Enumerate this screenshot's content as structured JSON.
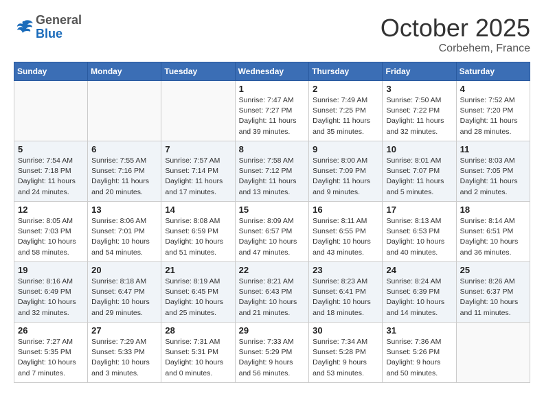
{
  "header": {
    "logo_general": "General",
    "logo_blue": "Blue",
    "month_title": "October 2025",
    "location": "Corbehem, France"
  },
  "days_of_week": [
    "Sunday",
    "Monday",
    "Tuesday",
    "Wednesday",
    "Thursday",
    "Friday",
    "Saturday"
  ],
  "weeks": [
    [
      {
        "day": "",
        "info": ""
      },
      {
        "day": "",
        "info": ""
      },
      {
        "day": "",
        "info": ""
      },
      {
        "day": "1",
        "info": "Sunrise: 7:47 AM\nSunset: 7:27 PM\nDaylight: 11 hours\nand 39 minutes."
      },
      {
        "day": "2",
        "info": "Sunrise: 7:49 AM\nSunset: 7:25 PM\nDaylight: 11 hours\nand 35 minutes."
      },
      {
        "day": "3",
        "info": "Sunrise: 7:50 AM\nSunset: 7:22 PM\nDaylight: 11 hours\nand 32 minutes."
      },
      {
        "day": "4",
        "info": "Sunrise: 7:52 AM\nSunset: 7:20 PM\nDaylight: 11 hours\nand 28 minutes."
      }
    ],
    [
      {
        "day": "5",
        "info": "Sunrise: 7:54 AM\nSunset: 7:18 PM\nDaylight: 11 hours\nand 24 minutes."
      },
      {
        "day": "6",
        "info": "Sunrise: 7:55 AM\nSunset: 7:16 PM\nDaylight: 11 hours\nand 20 minutes."
      },
      {
        "day": "7",
        "info": "Sunrise: 7:57 AM\nSunset: 7:14 PM\nDaylight: 11 hours\nand 17 minutes."
      },
      {
        "day": "8",
        "info": "Sunrise: 7:58 AM\nSunset: 7:12 PM\nDaylight: 11 hours\nand 13 minutes."
      },
      {
        "day": "9",
        "info": "Sunrise: 8:00 AM\nSunset: 7:09 PM\nDaylight: 11 hours\nand 9 minutes."
      },
      {
        "day": "10",
        "info": "Sunrise: 8:01 AM\nSunset: 7:07 PM\nDaylight: 11 hours\nand 5 minutes."
      },
      {
        "day": "11",
        "info": "Sunrise: 8:03 AM\nSunset: 7:05 PM\nDaylight: 11 hours\nand 2 minutes."
      }
    ],
    [
      {
        "day": "12",
        "info": "Sunrise: 8:05 AM\nSunset: 7:03 PM\nDaylight: 10 hours\nand 58 minutes."
      },
      {
        "day": "13",
        "info": "Sunrise: 8:06 AM\nSunset: 7:01 PM\nDaylight: 10 hours\nand 54 minutes."
      },
      {
        "day": "14",
        "info": "Sunrise: 8:08 AM\nSunset: 6:59 PM\nDaylight: 10 hours\nand 51 minutes."
      },
      {
        "day": "15",
        "info": "Sunrise: 8:09 AM\nSunset: 6:57 PM\nDaylight: 10 hours\nand 47 minutes."
      },
      {
        "day": "16",
        "info": "Sunrise: 8:11 AM\nSunset: 6:55 PM\nDaylight: 10 hours\nand 43 minutes."
      },
      {
        "day": "17",
        "info": "Sunrise: 8:13 AM\nSunset: 6:53 PM\nDaylight: 10 hours\nand 40 minutes."
      },
      {
        "day": "18",
        "info": "Sunrise: 8:14 AM\nSunset: 6:51 PM\nDaylight: 10 hours\nand 36 minutes."
      }
    ],
    [
      {
        "day": "19",
        "info": "Sunrise: 8:16 AM\nSunset: 6:49 PM\nDaylight: 10 hours\nand 32 minutes."
      },
      {
        "day": "20",
        "info": "Sunrise: 8:18 AM\nSunset: 6:47 PM\nDaylight: 10 hours\nand 29 minutes."
      },
      {
        "day": "21",
        "info": "Sunrise: 8:19 AM\nSunset: 6:45 PM\nDaylight: 10 hours\nand 25 minutes."
      },
      {
        "day": "22",
        "info": "Sunrise: 8:21 AM\nSunset: 6:43 PM\nDaylight: 10 hours\nand 21 minutes."
      },
      {
        "day": "23",
        "info": "Sunrise: 8:23 AM\nSunset: 6:41 PM\nDaylight: 10 hours\nand 18 minutes."
      },
      {
        "day": "24",
        "info": "Sunrise: 8:24 AM\nSunset: 6:39 PM\nDaylight: 10 hours\nand 14 minutes."
      },
      {
        "day": "25",
        "info": "Sunrise: 8:26 AM\nSunset: 6:37 PM\nDaylight: 10 hours\nand 11 minutes."
      }
    ],
    [
      {
        "day": "26",
        "info": "Sunrise: 7:27 AM\nSunset: 5:35 PM\nDaylight: 10 hours\nand 7 minutes."
      },
      {
        "day": "27",
        "info": "Sunrise: 7:29 AM\nSunset: 5:33 PM\nDaylight: 10 hours\nand 3 minutes."
      },
      {
        "day": "28",
        "info": "Sunrise: 7:31 AM\nSunset: 5:31 PM\nDaylight: 10 hours\nand 0 minutes."
      },
      {
        "day": "29",
        "info": "Sunrise: 7:33 AM\nSunset: 5:29 PM\nDaylight: 9 hours\nand 56 minutes."
      },
      {
        "day": "30",
        "info": "Sunrise: 7:34 AM\nSunset: 5:28 PM\nDaylight: 9 hours\nand 53 minutes."
      },
      {
        "day": "31",
        "info": "Sunrise: 7:36 AM\nSunset: 5:26 PM\nDaylight: 9 hours\nand 50 minutes."
      },
      {
        "day": "",
        "info": ""
      }
    ]
  ]
}
